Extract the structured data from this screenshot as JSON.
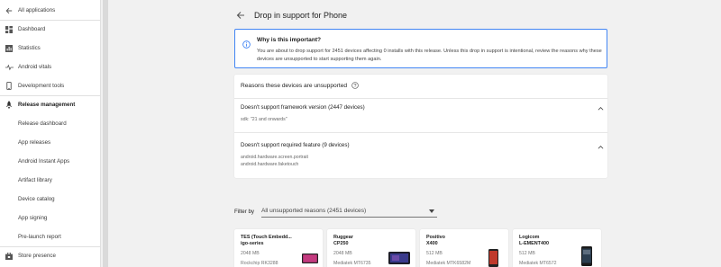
{
  "sidebar": {
    "back_label": "All applications",
    "items": [
      {
        "label": "Dashboard",
        "icon": "dashboard-icon"
      },
      {
        "label": "Statistics",
        "icon": "statistics-icon"
      },
      {
        "label": "Android vitals",
        "icon": "vitals-icon"
      },
      {
        "label": "Development tools",
        "icon": "phone-icon"
      },
      {
        "label": "Release management",
        "icon": "rocket-icon"
      },
      {
        "label": "Release dashboard"
      },
      {
        "label": "App releases"
      },
      {
        "label": "Android Instant Apps"
      },
      {
        "label": "Artifact library"
      },
      {
        "label": "Device catalog"
      },
      {
        "label": "App signing"
      },
      {
        "label": "Pre-launch report"
      },
      {
        "label": "Store presence",
        "icon": "store-icon"
      }
    ]
  },
  "page": {
    "title": "Drop in support for Phone"
  },
  "info": {
    "title": "Why is this important?",
    "body": "You are about to drop support for 2451 devices affecting 0 installs with this release. Unless this drop in support is intentional, review the reasons why these devices are unsupported to start supporting them again."
  },
  "reasons": {
    "header": "Reasons these devices are unsupported",
    "items": [
      {
        "title": "Doesn't support framework version (2447 devices)",
        "details": [
          "sdk: \"21 and onwards\""
        ]
      },
      {
        "title": "Doesn't support required feature (9 devices)",
        "details": [
          "android.hardware.screen.portrait",
          "android.hardware.faketouch"
        ]
      }
    ]
  },
  "filter": {
    "label": "Filter by",
    "selected": "All unsupported reasons (2451 devices)"
  },
  "devices": [
    {
      "name_line1": "TES (Touch Embedd...",
      "name_line2": "igo-series",
      "size": "2048 MB",
      "chip": "Rockchip RK3288"
    },
    {
      "name_line1": "Ruggear",
      "name_line2": "CP250",
      "size": "2048 MB",
      "chip": "Mediatek MT6735"
    },
    {
      "name_line1": "Positivo",
      "name_line2": "X400",
      "size": "512 MB",
      "chip": "Mediatek MTK6582M"
    },
    {
      "name_line1": "Logicom",
      "name_line2": "L-EMENT400",
      "size": "512 MB",
      "chip": "Mediatek MT6572"
    }
  ],
  "colors": {
    "accent": "#4285f4",
    "info_icon": "#4285f4"
  }
}
